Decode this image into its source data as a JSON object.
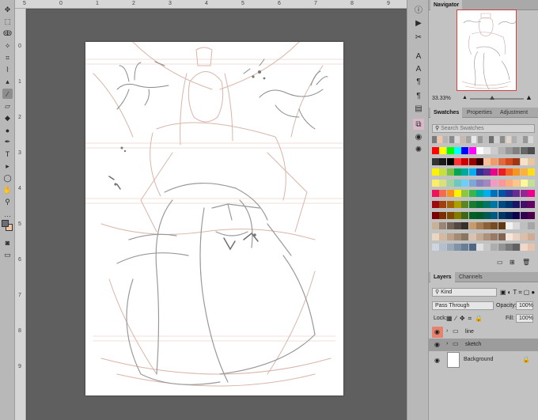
{
  "ruler_top_ticks": [
    "5",
    "0",
    "1",
    "2",
    "3",
    "4",
    "5",
    "6",
    "7",
    "8",
    "9"
  ],
  "ruler_left_ticks": [
    "0",
    "1",
    "2",
    "3",
    "4",
    "5",
    "6",
    "7",
    "8",
    "9"
  ],
  "toolbar": {
    "tools": [
      {
        "name": "move-tool-icon",
        "glyph": "✥"
      },
      {
        "name": "marquee-tool-icon",
        "glyph": "⬚"
      },
      {
        "name": "lasso-tool-icon",
        "glyph": "ↂ"
      },
      {
        "name": "magic-wand-tool-icon",
        "glyph": "✧"
      },
      {
        "name": "crop-tool-icon",
        "glyph": "⌗"
      },
      {
        "name": "eyedropper-tool-icon",
        "glyph": "⌇"
      },
      {
        "name": "stamp-tool-icon",
        "glyph": "▴"
      },
      {
        "name": "brush-tool-icon",
        "glyph": "∕"
      },
      {
        "name": "eraser-tool-icon",
        "glyph": "▱"
      },
      {
        "name": "paint-bucket-tool-icon",
        "glyph": "◆"
      },
      {
        "name": "smudge-tool-icon",
        "glyph": "●"
      },
      {
        "name": "pen-tool-icon",
        "glyph": "✒"
      },
      {
        "name": "type-tool-icon",
        "glyph": "T"
      },
      {
        "name": "path-selection-tool-icon",
        "glyph": "▸"
      },
      {
        "name": "ellipse-tool-icon",
        "glyph": "◯"
      },
      {
        "name": "hand-tool-icon",
        "glyph": "✋"
      },
      {
        "name": "zoom-tool-icon",
        "glyph": "⚲"
      },
      {
        "name": "more-tools-icon",
        "glyph": "…"
      }
    ],
    "active_index": 7
  },
  "right_icons": [
    {
      "name": "info-icon",
      "glyph": "ⓘ"
    },
    {
      "name": "play-icon",
      "glyph": "▶"
    },
    {
      "name": "scissors-icon",
      "glyph": "✂"
    },
    {
      "name": "character-icon",
      "glyph": "A"
    },
    {
      "name": "glyphs-icon",
      "glyph": "A"
    },
    {
      "name": "paragraph-icon",
      "glyph": "¶"
    },
    {
      "name": "paragraph-styles-icon",
      "glyph": "¶"
    },
    {
      "name": "table-icon",
      "glyph": "▤"
    },
    {
      "name": "brush-settings-icon",
      "glyph": "∕"
    },
    {
      "name": "clone-source-icon",
      "glyph": "⧉"
    },
    {
      "name": "swatches-mini-icon",
      "glyph": "◉"
    },
    {
      "name": "light-icon",
      "glyph": "✺"
    }
  ],
  "navigator": {
    "tab": "Navigator",
    "zoom": "33.33%"
  },
  "swatches": {
    "tabs": [
      "Swatches",
      "Properties",
      "Adjustment"
    ],
    "search_placeholder": "Search Swatches",
    "recent": [
      "#7a7a7a",
      "#f2c4a8",
      "#b5b5b5",
      "#8a8a8a",
      "#d9d9d9",
      "#c9b9ad",
      "#a4a4a4",
      "#e8e8e8",
      "#9a9a9a",
      "#bfbfbf",
      "#6f6f6f",
      "#d0d0d0",
      "#8c8c8c",
      "#e2d3c9",
      "#b0b0b0",
      "#c5c5c5",
      "#979797",
      "#d6d6d6"
    ],
    "colors": [
      "#ff0000",
      "#ffff00",
      "#00ff00",
      "#00ffff",
      "#0000ff",
      "#ff00ff",
      "#ffffff",
      "#e6e6e6",
      "#cccccc",
      "#b3b3b3",
      "#999999",
      "#808080",
      "#666666",
      "#4d4d4d",
      "#333333",
      "#1a1a1a",
      "#000000",
      "#ff3333",
      "#cc0000",
      "#990000",
      "#330000",
      "#f7c19a",
      "#f39a6b",
      "#e06a3c",
      "#d14b1e",
      "#a33612",
      "#f5e0c8",
      "#e8c79f",
      "#fff200",
      "#c8e03b",
      "#7dc242",
      "#00a651",
      "#00a99d",
      "#00aeef",
      "#2e3192",
      "#662d91",
      "#ec008c",
      "#ed1c24",
      "#f26522",
      "#f7941d",
      "#fbb040",
      "#ffde17",
      "#f9ed69",
      "#d7e27b",
      "#a3d39c",
      "#6dc8bf",
      "#6dcff6",
      "#7da7d9",
      "#8781bd",
      "#a187be",
      "#f49ac2",
      "#f6989d",
      "#f9ad81",
      "#fdc68a",
      "#fff79a",
      "#c4df9b",
      "#ed145b",
      "#f26c4f",
      "#f7941d",
      "#fff200",
      "#8dc63f",
      "#39b54a",
      "#00a99d",
      "#00aeef",
      "#0072bc",
      "#0054a6",
      "#2e3192",
      "#662d91",
      "#92278f",
      "#ec008c",
      "#9e0b0f",
      "#a0410d",
      "#a36209",
      "#aba000",
      "#598527",
      "#197b30",
      "#007236",
      "#00746b",
      "#0076a3",
      "#004a80",
      "#003471",
      "#1b1464",
      "#440e62",
      "#630460",
      "#790000",
      "#7b2e00",
      "#7d4900",
      "#827b00",
      "#406618",
      "#005e20",
      "#005826",
      "#005952",
      "#005b7f",
      "#003663",
      "#002157",
      "#0d004c",
      "#32004b",
      "#4b0049",
      "#c7b299",
      "#998675",
      "#736357",
      "#534741",
      "#37302a",
      "#c69c6d",
      "#a67c52",
      "#8c6239",
      "#754c24",
      "#603913",
      "#f2f2f2",
      "#d9d9d9",
      "#bfbfbf",
      "#a6a6a6",
      "#e8d5c4",
      "#d4b8a0",
      "#bca28a",
      "#a38b75",
      "#8a7462",
      "#d9c2b0",
      "#c4a995",
      "#ae917c",
      "#987a66",
      "#826452",
      "#f5e6db",
      "#e9d2c3",
      "#dcbfab",
      "#cfac95",
      "#cdd5de",
      "#b3bfcc",
      "#9aa9ba",
      "#8193a8",
      "#687d96",
      "#4f6784",
      "#e0e0e0",
      "#c7c7c7",
      "#adadad",
      "#949494",
      "#7a7a7a",
      "#616161",
      "#f0d7c7",
      "#e6c3ad"
    ]
  },
  "layers": {
    "tabs": [
      "Layers",
      "Channels"
    ],
    "filter_value": "Kind",
    "blend_mode": "Pass Through",
    "opacity_label": "Opacity:",
    "opacity_value": "100%",
    "lock_label": "Lock:",
    "fill_label": "Fill:",
    "fill_value": "100%",
    "items": [
      {
        "name": "line",
        "type": "group",
        "eye_highlight": true,
        "selected": false
      },
      {
        "name": "sketch",
        "type": "group",
        "eye_highlight": false,
        "selected": true
      },
      {
        "name": "Background",
        "type": "background",
        "eye_highlight": false,
        "selected": false
      }
    ]
  }
}
